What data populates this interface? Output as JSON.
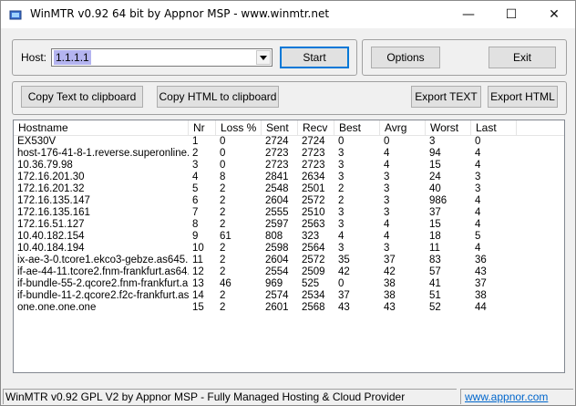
{
  "window": {
    "title": "WinMTR v0.92 64 bit by Appnor MSP - www.winmtr.net",
    "minimize_glyph": "—",
    "maximize_glyph": "☐",
    "close_glyph": "✕"
  },
  "controls": {
    "host_label": "Host:",
    "host_value": "1.1.1.1",
    "start_label": "Start",
    "options_label": "Options",
    "exit_label": "Exit",
    "copy_text_label": "Copy Text to clipboard",
    "copy_html_label": "Copy HTML to clipboard",
    "export_text_label": "Export TEXT",
    "export_html_label": "Export HTML"
  },
  "table": {
    "columns": [
      "Hostname",
      "Nr",
      "Loss %",
      "Sent",
      "Recv",
      "Best",
      "Avrg",
      "Worst",
      "Last"
    ],
    "rows": [
      [
        "EX530V",
        "1",
        "0",
        "2724",
        "2724",
        "0",
        "0",
        "3",
        "0"
      ],
      [
        "host-176-41-8-1.reverse.superonline....",
        "2",
        "0",
        "2723",
        "2723",
        "3",
        "4",
        "94",
        "4"
      ],
      [
        "10.36.79.98",
        "3",
        "0",
        "2723",
        "2723",
        "3",
        "4",
        "15",
        "4"
      ],
      [
        "172.16.201.30",
        "4",
        "8",
        "2841",
        "2634",
        "3",
        "3",
        "24",
        "3"
      ],
      [
        "172.16.201.32",
        "5",
        "2",
        "2548",
        "2501",
        "2",
        "3",
        "40",
        "3"
      ],
      [
        "172.16.135.147",
        "6",
        "2",
        "2604",
        "2572",
        "2",
        "3",
        "986",
        "4"
      ],
      [
        "172.16.135.161",
        "7",
        "2",
        "2555",
        "2510",
        "3",
        "3",
        "37",
        "4"
      ],
      [
        "172.16.51.127",
        "8",
        "2",
        "2597",
        "2563",
        "3",
        "4",
        "15",
        "4"
      ],
      [
        "10.40.182.154",
        "9",
        "61",
        "808",
        "323",
        "4",
        "4",
        "18",
        "5"
      ],
      [
        "10.40.184.194",
        "10",
        "2",
        "2598",
        "2564",
        "3",
        "3",
        "11",
        "4"
      ],
      [
        "ix-ae-3-0.tcore1.ekco3-gebze.as645...",
        "11",
        "2",
        "2604",
        "2572",
        "35",
        "37",
        "83",
        "36"
      ],
      [
        "if-ae-44-11.tcore2.fnm-frankfurt.as64...",
        "12",
        "2",
        "2554",
        "2509",
        "42",
        "42",
        "57",
        "43"
      ],
      [
        "if-bundle-55-2.qcore2.fnm-frankfurt.a...",
        "13",
        "46",
        "969",
        "525",
        "0",
        "38",
        "41",
        "37"
      ],
      [
        "if-bundle-11-2.qcore2.f2c-frankfurt.as...",
        "14",
        "2",
        "2574",
        "2534",
        "37",
        "38",
        "51",
        "38"
      ],
      [
        "one.one.one.one",
        "15",
        "2",
        "2601",
        "2568",
        "43",
        "43",
        "52",
        "44"
      ]
    ]
  },
  "status_bar": {
    "text": "WinMTR v0.92 GPL V2 by Appnor MSP - Fully Managed Hosting & Cloud Provider",
    "link": "www.appnor.com"
  },
  "colors": {
    "accent": "#0078d7",
    "selection": "#b4b4f0",
    "link": "#0066cc"
  }
}
